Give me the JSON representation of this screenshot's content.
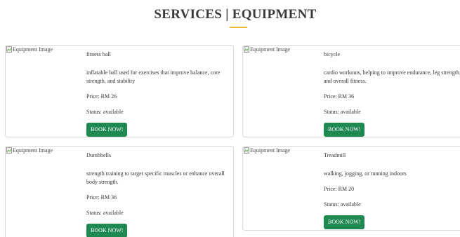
{
  "page": {
    "title": "SERVICES | EQUIPMENT",
    "accent_color": "#e8b931",
    "button_color": "#1e8a52"
  },
  "items": [
    {
      "image_alt": "Equipment Image",
      "name": "fitness ball",
      "description": "inflatable ball used for exercises that improve balance, core strength, and stability",
      "price": "Price: RM 26",
      "status": "Status: available",
      "button_label": "BOOK NOW!"
    },
    {
      "image_alt": "Equipment Image",
      "name": "bicycle",
      "description": "cardio workouts, helping to improve endurance, leg strength, and overall fitness.",
      "price": "Price: RM 36",
      "status": "Status: available",
      "button_label": "BOOK NOW!"
    },
    {
      "image_alt": "Equipment Image",
      "name": "Dumbbells",
      "description": "strength training to target specific muscles or enhance overall body strength.",
      "price": "Price: RM 36",
      "status": "Status: available",
      "button_label": "BOOK NOW!"
    },
    {
      "image_alt": "Equipment Image",
      "name": "Treadmill",
      "description": "walking, jogging, or running indoors",
      "price": "Price: RM 20",
      "status": "Status: available",
      "button_label": "BOOK NOW!"
    }
  ]
}
